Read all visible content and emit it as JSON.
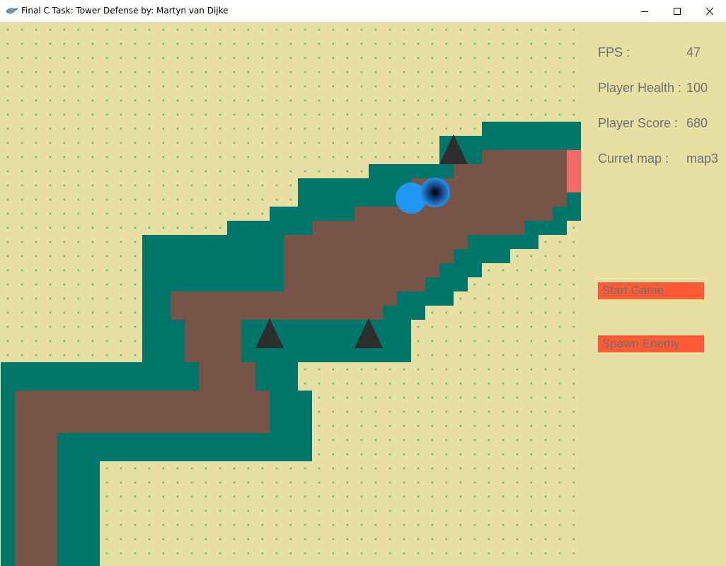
{
  "window": {
    "title": "Final C Task: Tower Defense by: Martyn van Dijke",
    "icon": "bird-icon",
    "controls": [
      "minimize-icon",
      "maximize-icon",
      "close-icon"
    ]
  },
  "colors": {
    "background": "#e8dfa3",
    "dots": "#5cc08a",
    "grass": "#00766a",
    "path": "#765548",
    "base": "#f26b6b",
    "tower": "#2d2d2d",
    "enemy": "#2196f3",
    "button": "#ff5a33",
    "hud_text": "#6b7077"
  },
  "hud": {
    "fps_label": "FPS :",
    "fps_value": "47",
    "health_label": "Player Health :",
    "health_value": "100",
    "score_label": "Player Score :",
    "score_value": "680",
    "map_label": "Curret map :",
    "map_value": "map3"
  },
  "buttons": {
    "start_game": "Start Game",
    "spawn_enemy": "Spawn Enemy"
  },
  "map": {
    "cols": 41,
    "rows": 39,
    "legend": {
      ".": "sand",
      "G": "grass",
      "P": "path",
      "B": "base"
    },
    "grid": [
      ".........................................",
      ".........................................",
      ".........................................",
      ".........................................",
      ".........................................",
      ".........................................",
      ".........................................",
      "..................................GGGGGGG",
      "...............................GGGGGGGGGG",
      "...............................GGGPPPPPPB",
      "..........................GGGGGGPPPPPPPPB",
      ".....................GGGGGGGGPPPPPPPPPPPB",
      ".....................GGGGGGGPPPPPPPPPPPPG",
      "...................GGGGGGPPPPPPPPPPPPPPGG",
      "................GGGGGGPPPPPPPPPPPPPPPGGG.",
      "..........GGGGGGGGGGPPPPPPPPPPPPPGGGGG...",
      "..........GGGGGGGGGGPPPPPPPPPPPPGGGG.....",
      "..........GGGGGGGGGGPPPPPPPPPPPGGG.......",
      "..........GGGGGGGGGGPPPPPPPPPPGGG........",
      "..........GGPPPPPPPPPPPPPPPPGGGG.........",
      "..........GGPPPPPPPPPPPPPPPGGG...........",
      "..........GGGPPPPGGGGGGGGGGGG............",
      "..........GGGPPPPGGGGGGGGGGGG............",
      "..........GGGPPPPGGGGGGGGGGGG............",
      "GGGGGGGGGGGGGGPPPPGGG....................",
      "GGGGGGGGGGGGGGPPPPGGG....................",
      "GPPPPPPPPPPPPPPPPPPGGG...................",
      "GPPPPPPPPPPPPPPPPPPGGG...................",
      "GPPPPPPPPPPPPPPPPPPGGG...................",
      "GPPPGGGGGGGGGGGGGGGGGG...................",
      "GPPPGGGGGGGGGGGGGGGGGG...................",
      "GPPPGGG..................................",
      "GPPPGGG..................................",
      "GPPPGGG..................................",
      "GPPPGGG..................................",
      "GPPPGGG..................................",
      "GPPPGGG..................................",
      "GPPPGGG..................................",
      "GPPPGGG.................................."
    ],
    "towers": [
      [
        32,
        9
      ],
      [
        19,
        22
      ],
      [
        26,
        22
      ]
    ],
    "enemies": [
      {
        "cell": [
          29,
          12.4
        ],
        "style": "solid"
      },
      {
        "cell": [
          30.7,
          12
        ],
        "style": "glow"
      }
    ]
  }
}
